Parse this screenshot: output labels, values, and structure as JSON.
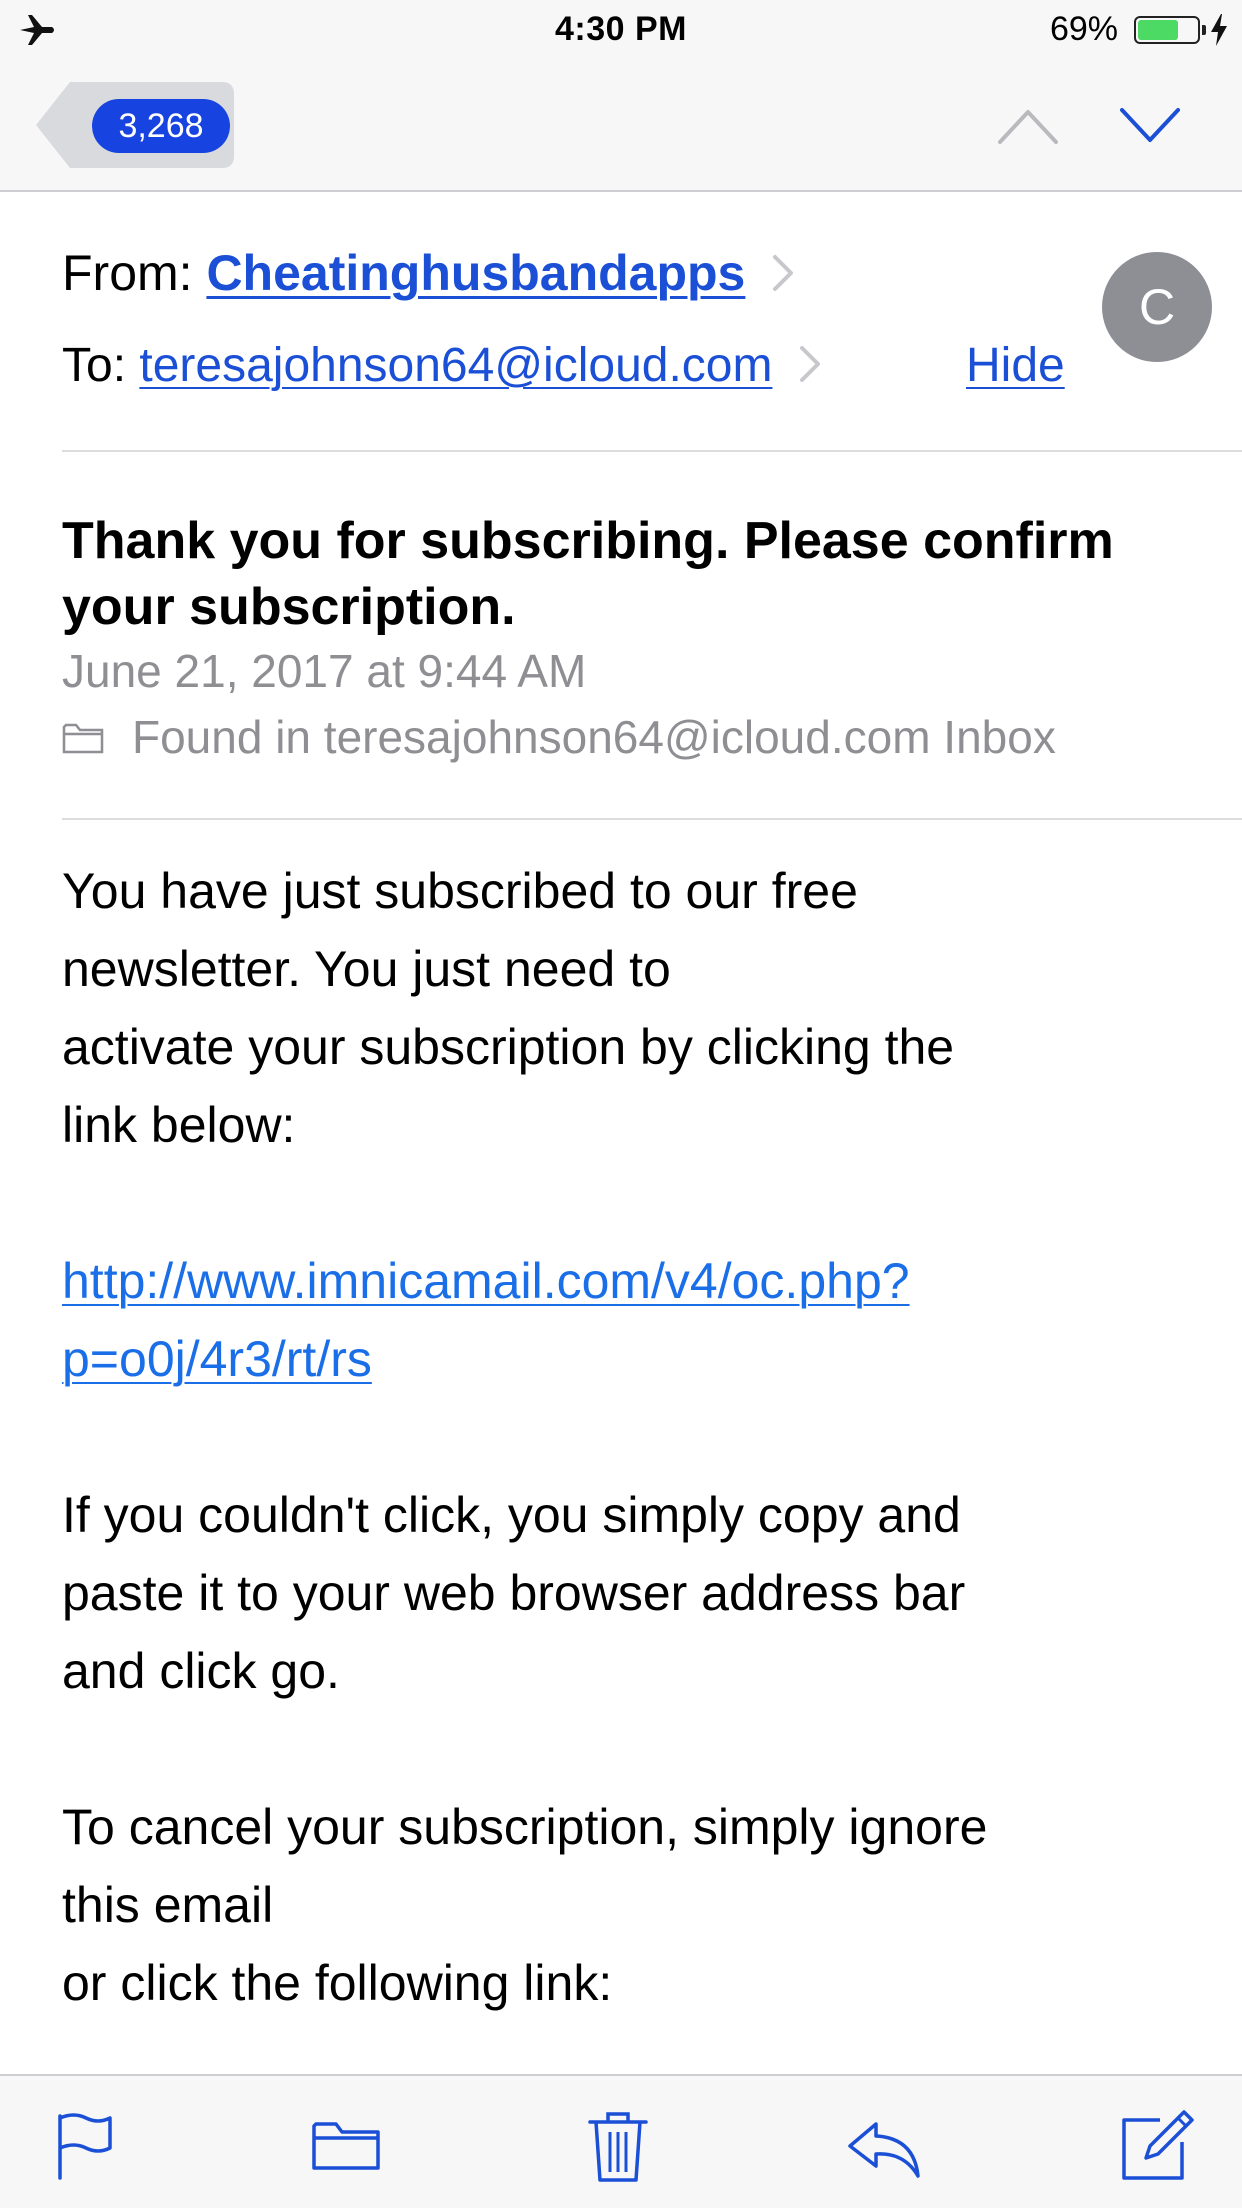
{
  "status_bar": {
    "time": "4:30 PM",
    "battery_percent": "69%",
    "battery_level": 0.69,
    "airplane_mode": true,
    "charging": true,
    "icons": [
      "airplane-icon",
      "battery-icon",
      "charging-bolt-icon"
    ]
  },
  "nav": {
    "back_count": "3,268",
    "icons": [
      "previous-message-icon",
      "next-message-icon"
    ],
    "colors": {
      "badge": "#1744e0",
      "accent": "#1a4fd6"
    }
  },
  "header": {
    "from_label": "From:",
    "sender": "Cheatinghusbandapps",
    "to_label": "To:",
    "recipient": "teresajohnson64@icloud.com",
    "hide_label": "Hide",
    "avatar_initial": "C"
  },
  "subject": "Thank you for subscribing. Please confirm your subscription.",
  "date": "June 21, 2017 at 9:44 AM",
  "found_in": "Found in teresajohnson64@icloud.com Inbox",
  "body": {
    "p1": [
      "You have just subscribed to our free",
      "newsletter.  You just need to",
      "activate your subscription by clicking the",
      "link below:"
    ],
    "link_lines": [
      "http://www.imnicamail.com/v4/oc.php?",
      "p=o0j/4r3/rt/rs"
    ],
    "p2": [
      "If you couldn't click, you simply copy and",
      "paste it to your web browser address bar",
      "and click go."
    ],
    "p3": [
      "To cancel your subscription, simply ignore",
      "this email",
      "or click the following link:"
    ]
  },
  "toolbar": {
    "icons": [
      "flag-icon",
      "folder-move-icon",
      "trash-icon",
      "reply-icon",
      "compose-icon"
    ]
  }
}
